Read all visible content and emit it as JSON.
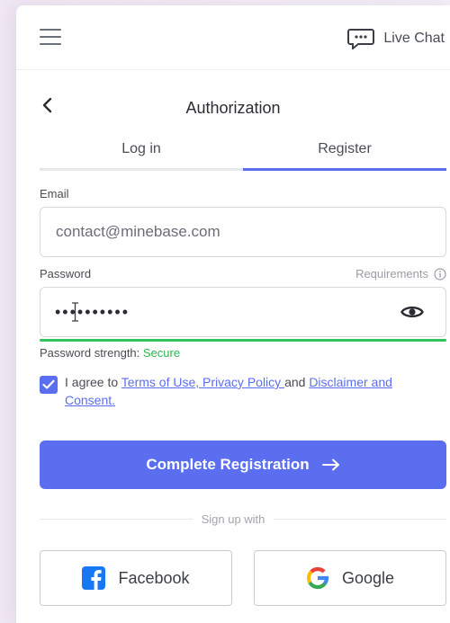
{
  "topbar": {
    "menu_icon": "hamburger-menu-icon",
    "live_chat_label": "Live Chat",
    "chat_icon": "chat-bubble-icon"
  },
  "auth": {
    "title": "Authorization",
    "back_icon": "chevron-left-icon",
    "tabs": [
      {
        "label": "Log in",
        "active": false
      },
      {
        "label": "Register",
        "active": true
      }
    ]
  },
  "form": {
    "email": {
      "label": "Email",
      "value": "contact@minebase.com"
    },
    "password": {
      "label": "Password",
      "masked_value": "••••••••••",
      "requirements_label": "Requirements",
      "strength_label": "Password strength:",
      "strength_value": "Secure"
    },
    "agreement": {
      "checked": true,
      "prefix": "I agree to ",
      "terms_link": "Terms of Use, Privacy Policy ",
      "middle": "and ",
      "disclaimer_link": "Disclaimer and Consent."
    },
    "submit_label": "Complete Registration"
  },
  "social": {
    "divider_label": "Sign up with",
    "facebook_label": "Facebook",
    "google_label": "Google"
  },
  "colors": {
    "accent": "#5b6ef0",
    "strength_green": "#2fb553",
    "facebook_blue": "#1877f2"
  }
}
